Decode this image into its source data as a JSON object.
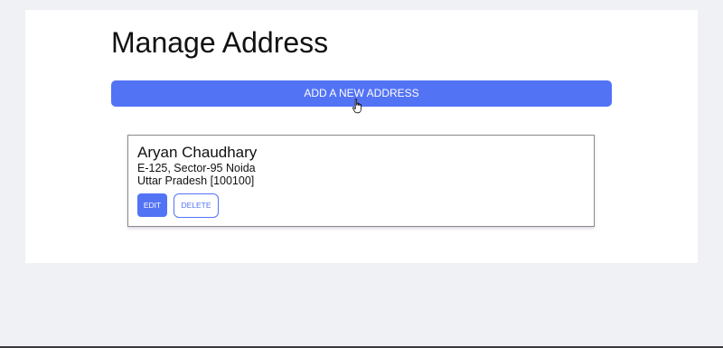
{
  "page": {
    "title": "Manage Address"
  },
  "actions": {
    "add_label": "ADD A NEW ADDRESS"
  },
  "addresses": [
    {
      "name": "Aryan Chaudhary",
      "line1": "E-125, Sector-95 Noida",
      "line2": "Uttar Pradesh [100100]",
      "edit_label": "EDIT",
      "delete_label": "DELETE"
    }
  ],
  "colors": {
    "accent": "#5373f5",
    "page_background": "#f0f1f5",
    "panel_background": "#ffffff"
  },
  "icons": {
    "cursor": "hand-pointer-icon"
  }
}
